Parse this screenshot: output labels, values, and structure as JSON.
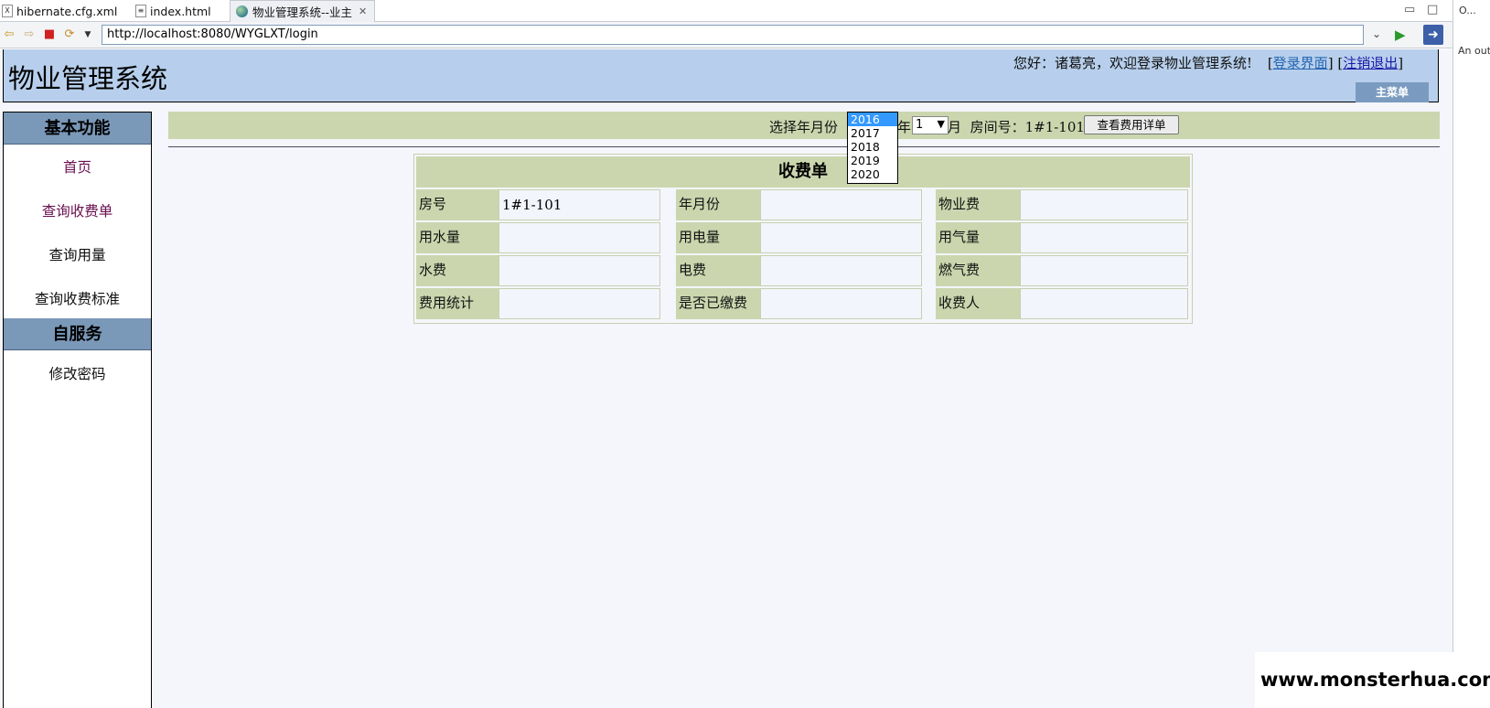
{
  "ide_tabs": [
    {
      "label": "hibernate.cfg.xml",
      "icon": "xml-file-icon"
    },
    {
      "label": "index.html",
      "icon": "html-file-icon"
    },
    {
      "label": "物业管理系统--业主",
      "icon": "globe-icon"
    }
  ],
  "browser": {
    "url": "http://localhost:8080/WYGLXT/login"
  },
  "outline": {
    "title": "O...",
    "note": "An out"
  },
  "header": {
    "system_name": "物业管理系统",
    "welcome_text": "您好：诸葛亮，欢迎登录物业管理系统!",
    "login_link": "登录界面",
    "logout_link": "注销退出",
    "bracket_open": "[",
    "bracket_close": "]",
    "main_menu": "主菜单"
  },
  "sidebar": {
    "sections": [
      {
        "title": "基本功能",
        "items": [
          "首页",
          "查询收费单",
          "查询用量",
          "查询收费标准"
        ]
      },
      {
        "title": "自服务",
        "items": [
          "修改密码"
        ]
      }
    ]
  },
  "query": {
    "label_select": "选择年月份",
    "year_selected": "2016",
    "year_options": [
      "2016",
      "2017",
      "2018",
      "2019",
      "2020"
    ],
    "label_year": "年",
    "month_selected": "1",
    "label_month": "月",
    "room_label": "房间号：",
    "room_value": "1#1-101",
    "view_button": "查看费用详单"
  },
  "fee_table": {
    "title": "收费单",
    "rows": [
      [
        {
          "label": "房号",
          "value": "1#1-101"
        },
        {
          "label": "年月份",
          "value": ""
        },
        {
          "label": "物业费",
          "value": ""
        }
      ],
      [
        {
          "label": "用水量",
          "value": ""
        },
        {
          "label": "用电量",
          "value": ""
        },
        {
          "label": "用气量",
          "value": ""
        }
      ],
      [
        {
          "label": "水费",
          "value": ""
        },
        {
          "label": "电费",
          "value": ""
        },
        {
          "label": "燃气费",
          "value": ""
        }
      ],
      [
        {
          "label": "费用统计",
          "value": ""
        },
        {
          "label": "是否已缴费",
          "value": ""
        },
        {
          "label": "收费人",
          "value": ""
        }
      ]
    ]
  },
  "watermark": "www.monsterhua.com",
  "colors": {
    "header_bg": "#b7cfec",
    "nav_head_bg": "#7a98b8",
    "table_label_bg": "#cbd6ae",
    "page_bg": "#f4f6fb"
  }
}
